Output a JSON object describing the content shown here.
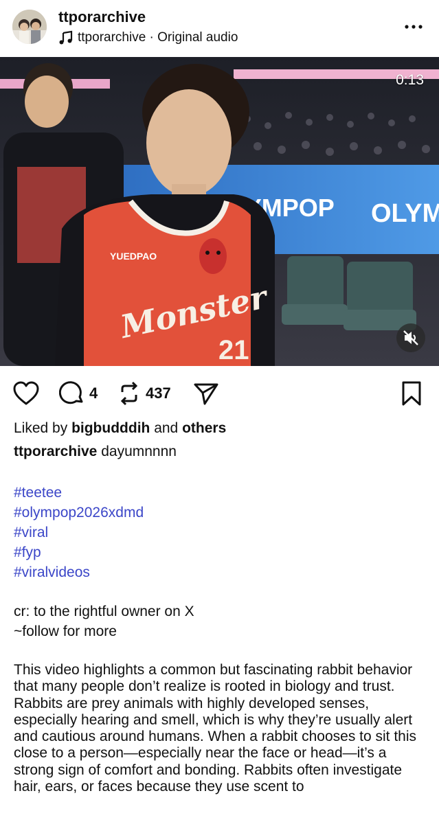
{
  "header": {
    "username": "ttporarchive",
    "audio_text": "ttporarchive · Original audio",
    "avatar_icon": "avatar-photo",
    "more_icon": "more-dots-icon"
  },
  "video": {
    "timestamp": "0:13",
    "jersey_brand": "YUEDPAO",
    "jersey_script": "Monster",
    "jersey_number": "21",
    "banner_text_left": "OLYMPOP",
    "banner_text_right": "OLYM",
    "mute_icon": "volume-muted-icon"
  },
  "actions": {
    "comments": "4",
    "reposts": "437"
  },
  "post": {
    "liked_prefix": "Liked by ",
    "liked_user": "bigbudddih",
    "liked_mid": " and ",
    "liked_others": "others",
    "caption_user": "ttporarchive",
    "caption_text": " dayumnnnn",
    "hashtags": [
      "#teetee",
      "#olympop2026xdmd",
      "#viral",
      "#fyp",
      "#viralvideos"
    ],
    "credit_line1": "cr: to the rightful owner on X",
    "credit_line2": "~follow for more",
    "description": "This video highlights a common but fascinating rabbit behavior that many people don’t realize is rooted in biology and trust. Rabbits are prey animals with highly developed senses, especially hearing and smell, which is why they’re usually alert and cautious around humans. When a rabbit chooses to sit this close to a person—especially near the face or head—it’s a strong sign of comfort and bonding. Rabbits often investigate hair, ears, or faces because they use scent to"
  },
  "colors": {
    "hashtag": "#3b46c8",
    "jersey": "#e2513a",
    "banner": "#3a86d6"
  }
}
